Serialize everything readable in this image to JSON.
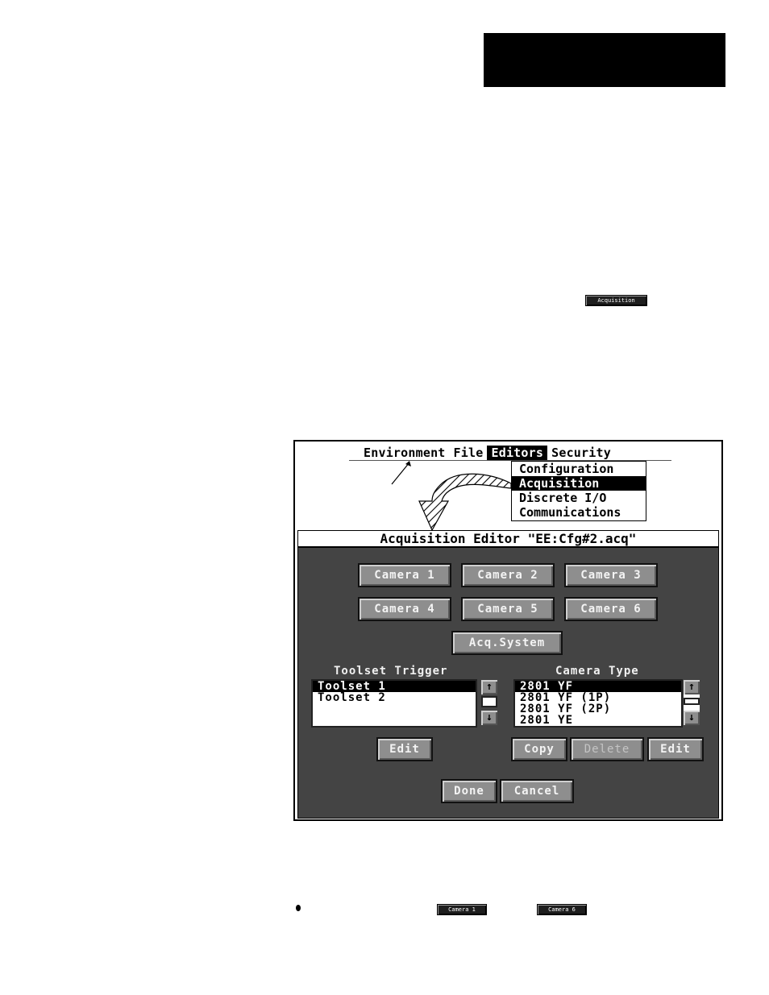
{
  "page": {
    "header_block": "black header tab",
    "inline_buttons": {
      "acquisition": "Acquisition",
      "camera_first": "Camera 1",
      "camera_last": "Camera 6"
    },
    "bullet": "•"
  },
  "figure": {
    "menubar": {
      "items": [
        {
          "label": "Environment",
          "active": false
        },
        {
          "label": "File",
          "active": false
        },
        {
          "label": "Editors",
          "active": true
        },
        {
          "label": "Security",
          "active": false
        }
      ]
    },
    "editors_menu": {
      "items": [
        {
          "label": "Configuration",
          "selected": false
        },
        {
          "label": "Acquisition",
          "selected": true
        },
        {
          "label": "Discrete I/O",
          "selected": false
        },
        {
          "label": "Communications",
          "selected": false
        }
      ]
    },
    "editor": {
      "title": "Acquisition Editor \"EE:Cfg#2.acq\"",
      "camera_buttons": [
        "Camera 1",
        "Camera 2",
        "Camera 3",
        "Camera 4",
        "Camera 5",
        "Camera 6"
      ],
      "acq_system_button": "Acq.System",
      "toolset_trigger": {
        "label": "Toolset Trigger",
        "items": [
          "Toolset 1",
          "Toolset 2"
        ],
        "selected_index": 0,
        "edit_button": "Edit"
      },
      "camera_type": {
        "label": "Camera Type",
        "items": [
          "2801 YF",
          "2801 YF (1P)",
          "2801 YF (2P)",
          "2801 YE"
        ],
        "selected_index": 0,
        "copy_button": "Copy",
        "delete_button": "Delete",
        "delete_enabled": false,
        "edit_button": "Edit"
      },
      "done_button": "Done",
      "cancel_button": "Cancel"
    },
    "scroll_icons": {
      "up": "↑",
      "down": "↓"
    }
  }
}
